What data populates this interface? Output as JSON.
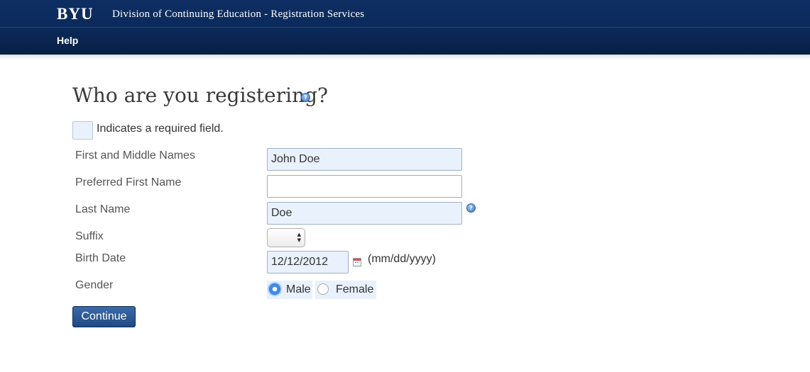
{
  "header": {
    "brand": "BYU",
    "division": "Division of Continuing Education - Registration Services",
    "nav": {
      "help_label": "Help"
    }
  },
  "page": {
    "title": "Who are you registering?",
    "required_note": "Indicates a required field."
  },
  "form": {
    "first_middle_names": {
      "label": "First and Middle Names",
      "value": "John Doe",
      "required": true
    },
    "preferred_first_name": {
      "label": "Preferred First Name",
      "value": "",
      "required": false
    },
    "last_name": {
      "label": "Last Name",
      "value": "Doe",
      "required": true
    },
    "suffix": {
      "label": "Suffix",
      "value": ""
    },
    "birth_date": {
      "label": "Birth Date",
      "value": "12/12/2012",
      "format_hint": "(mm/dd/yyyy)",
      "required": true
    },
    "gender": {
      "label": "Gender",
      "options": [
        "Male",
        "Female"
      ],
      "selected": "Male"
    },
    "continue_label": "Continue"
  },
  "colors": {
    "header_bg": "#0e2e63",
    "required_field_bg": "#e8f1fc",
    "button_bg": "#2a5794"
  }
}
